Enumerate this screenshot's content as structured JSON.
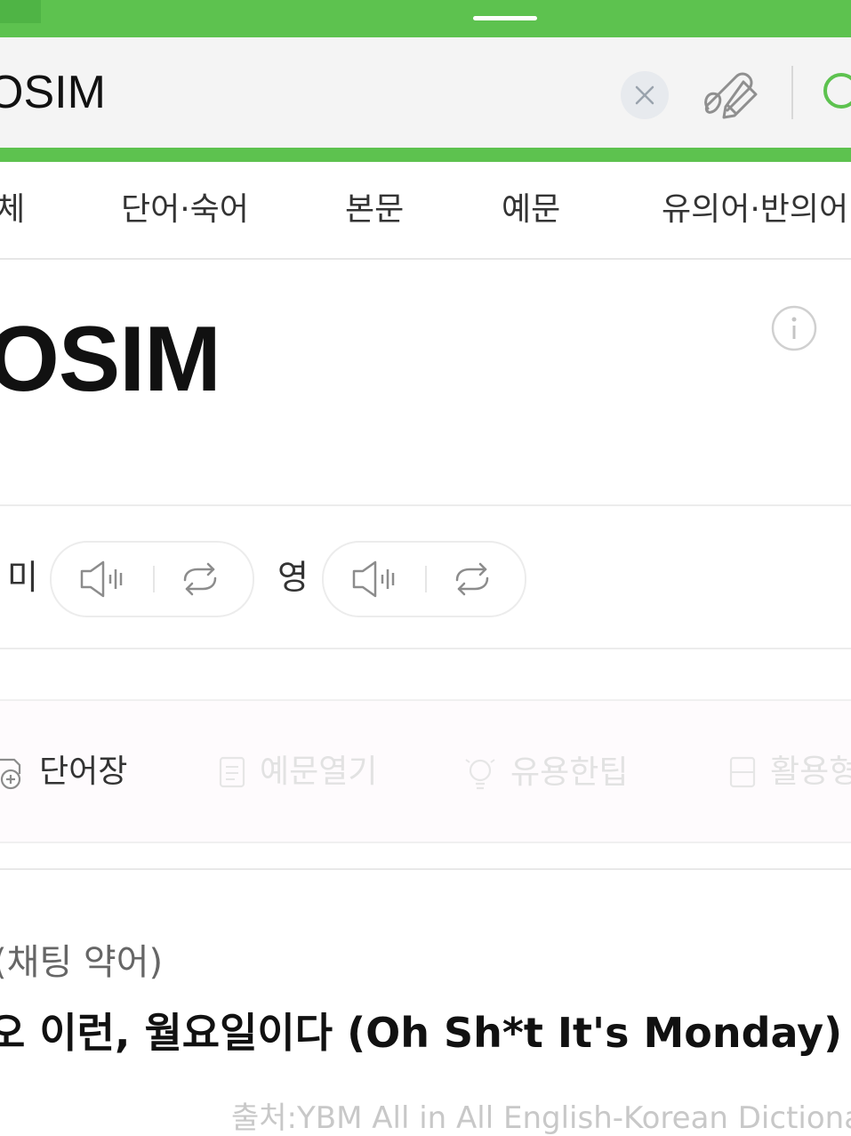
{
  "search": {
    "query": "OSIM"
  },
  "tabs": [
    {
      "label": "전체"
    },
    {
      "label": "단어·숙어"
    },
    {
      "label": "본문"
    },
    {
      "label": "예문"
    },
    {
      "label": "유의어·반의어"
    }
  ],
  "entry": {
    "headword": "OSIM",
    "pronunciation": {
      "us_label": "미",
      "uk_label": "영"
    },
    "tools": [
      {
        "label": "단어장",
        "icon": "add-wordbook-icon",
        "state": "enabled"
      },
      {
        "label": "예문열기",
        "icon": "document-icon",
        "state": "disabled"
      },
      {
        "label": "유용한팁",
        "icon": "lightbulb-icon",
        "state": "disabled"
      },
      {
        "label": "활용형",
        "icon": "list-icon",
        "state": "disabled"
      }
    ],
    "part_of_speech": "(채팅 약어)",
    "meaning": "오 이런, 월요일이다 (Oh Sh*t It's Monday)",
    "source": "출처:YBM All in All English-Korean Dictionary"
  },
  "colors": {
    "brand_green": "#5dc24f",
    "search_bg": "#f4f4f4",
    "disabled_text": "#e2e2e2"
  }
}
